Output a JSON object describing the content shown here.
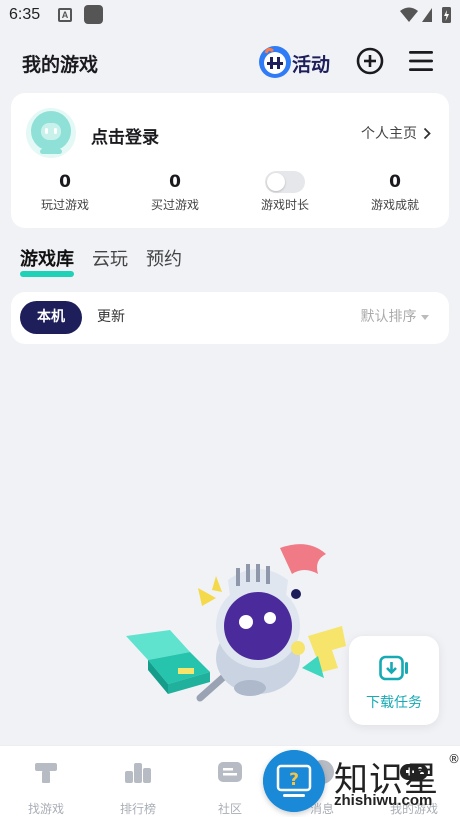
{
  "status_bar": {
    "time": "6:35",
    "app_icon_letter": "A"
  },
  "header": {
    "title": "我的游戏",
    "activity_label": "活动"
  },
  "profile": {
    "login_text": "点击登录",
    "home_link": "个人主页",
    "stats": [
      {
        "value": "0",
        "label": "玩过游戏"
      },
      {
        "value": "0",
        "label": "买过游戏"
      },
      {
        "value": "",
        "label": "游戏时长"
      },
      {
        "value": "0",
        "label": "游戏成就"
      }
    ]
  },
  "tabs": [
    {
      "label": "游戏库",
      "active": true
    },
    {
      "label": "云玩",
      "active": false
    },
    {
      "label": "预约",
      "active": false
    }
  ],
  "filter": {
    "local": "本机",
    "update": "更新",
    "sort": "默认排序"
  },
  "download_fab": {
    "label": "下载任务"
  },
  "bottom_nav": [
    {
      "label": "找游戏",
      "icon": "hammer-icon"
    },
    {
      "label": "排行榜",
      "icon": "ranking-icon"
    },
    {
      "label": "社区",
      "icon": "community-icon"
    },
    {
      "label": "消息",
      "icon": "message-icon"
    },
    {
      "label": "我的游戏",
      "icon": "gamepad-icon"
    }
  ],
  "watermark": {
    "main": "知识星",
    "sub": "zhishiwu.com"
  },
  "colors": {
    "accent": "#1fd1b6",
    "primary_dark": "#1d1e5a",
    "teal_text": "#16aab4",
    "help_blue": "#1a8ad8"
  }
}
